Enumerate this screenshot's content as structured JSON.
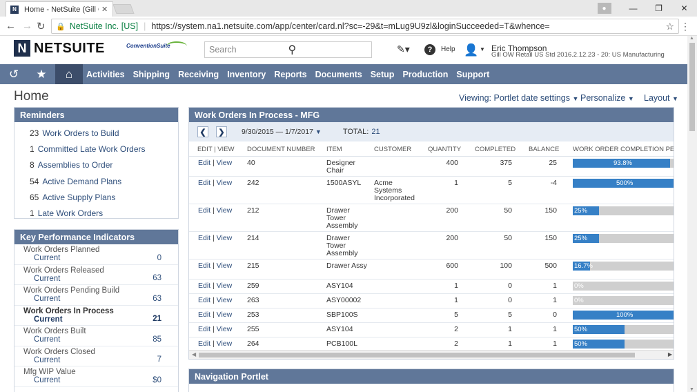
{
  "browser": {
    "tab_title": "Home - NetSuite (Gill OV",
    "tab_icon": "N",
    "secure_label": "NetSuite Inc. [US]",
    "url": "https://system.na1.netsuite.com/app/center/card.nl?sc=-29&t=mLug9U9zl&loginSucceeded=T&whence="
  },
  "header": {
    "brand": "NETSUITE",
    "brand_mark": "N",
    "partner_logo": "ConventionSuite",
    "search_placeholder": "Search",
    "help_label": "Help",
    "user_name": "Eric Thompson",
    "user_role": "Gill OW Retail US Std 2016.2.12.23 - 20: US Manufacturing"
  },
  "nav": {
    "items": [
      "Activities",
      "Shipping",
      "Receiving",
      "Inventory",
      "Reports",
      "Documents",
      "Setup",
      "Production",
      "Support"
    ]
  },
  "page": {
    "title": "Home",
    "viewing": "Viewing: Portlet date settings",
    "personalize": "Personalize",
    "layout": "Layout"
  },
  "reminders": {
    "title": "Reminders",
    "items": [
      {
        "count": "23",
        "label": "Work Orders to Build"
      },
      {
        "count": "1",
        "label": "Committed Late Work Orders"
      },
      {
        "count": "8",
        "label": "Assemblies to Order"
      },
      {
        "count": "54",
        "label": "Active Demand Plans"
      },
      {
        "count": "65",
        "label": "Active Supply Plans"
      },
      {
        "count": "1",
        "label": "Late Work Orders"
      }
    ]
  },
  "kpi": {
    "title": "Key Performance Indicators",
    "rows": [
      {
        "name": "Work Orders Planned",
        "sub": "Current",
        "value": "0"
      },
      {
        "name": "Work Orders Released",
        "sub": "Current",
        "value": "63"
      },
      {
        "name": "Work Orders Pending Build",
        "sub": "Current",
        "value": "63"
      },
      {
        "name": "Work Orders In Process",
        "sub": "Current",
        "value": "21"
      },
      {
        "name": "Work Orders Built",
        "sub": "Current",
        "value": "85"
      },
      {
        "name": "Work Orders Closed",
        "sub": "Current",
        "value": "7"
      },
      {
        "name": "Mfg WIP Value",
        "sub": "Current",
        "value": "$0"
      }
    ]
  },
  "work_orders": {
    "title": "Work Orders In Process - MFG",
    "date_range": "9/30/2015 — 1/7/2017",
    "total_label": "TOTAL:",
    "total_value": "21",
    "columns": [
      "EDIT | VIEW",
      "DOCUMENT NUMBER",
      "ITEM",
      "CUSTOMER",
      "QUANTITY",
      "COMPLETED",
      "BALANCE",
      "WORK ORDER COMPLETION PERC"
    ],
    "edit_label": "Edit",
    "view_label": "View",
    "rows": [
      {
        "doc": "40",
        "item": "Designer Chair",
        "customer": "",
        "qty": "400",
        "completed": "375",
        "balance": "25",
        "pct_label": "93.8%",
        "pct": 0.938
      },
      {
        "doc": "242",
        "item": "1500ASYL",
        "customer": "Acme Systems Incorporated",
        "qty": "1",
        "completed": "5",
        "balance": "-4",
        "pct_label": "500%",
        "pct": 1.0
      },
      {
        "doc": "212",
        "item": "Drawer Tower Assembly",
        "customer": "",
        "qty": "200",
        "completed": "50",
        "balance": "150",
        "pct_label": "25%",
        "pct": 0.25
      },
      {
        "doc": "214",
        "item": "Drawer Tower Assembly",
        "customer": "",
        "qty": "200",
        "completed": "50",
        "balance": "150",
        "pct_label": "25%",
        "pct": 0.25
      },
      {
        "doc": "215",
        "item": "Drawer Assy",
        "customer": "",
        "qty": "600",
        "completed": "100",
        "balance": "500",
        "pct_label": "16.7%",
        "pct": 0.167
      },
      {
        "doc": "259",
        "item": "ASY104",
        "customer": "",
        "qty": "1",
        "completed": "0",
        "balance": "1",
        "pct_label": "0%",
        "pct": 0
      },
      {
        "doc": "263",
        "item": "ASY00002",
        "customer": "",
        "qty": "1",
        "completed": "0",
        "balance": "1",
        "pct_label": "0%",
        "pct": 0
      },
      {
        "doc": "253",
        "item": "SBP100S",
        "customer": "",
        "qty": "5",
        "completed": "5",
        "balance": "0",
        "pct_label": "100%",
        "pct": 1.0
      },
      {
        "doc": "255",
        "item": "ASY104",
        "customer": "",
        "qty": "2",
        "completed": "1",
        "balance": "1",
        "pct_label": "50%",
        "pct": 0.5
      },
      {
        "doc": "264",
        "item": "PCB100L",
        "customer": "",
        "qty": "2",
        "completed": "1",
        "balance": "1",
        "pct_label": "50%",
        "pct": 0.5
      }
    ]
  },
  "nav_portlet": {
    "title": "Navigation Portlet"
  },
  "colors": {
    "nav_bg": "#607799",
    "nav_active": "#3c4d6a",
    "link": "#2d4d7a",
    "bar_fill": "#3680c6",
    "bar_bg": "#cfcfcf"
  }
}
